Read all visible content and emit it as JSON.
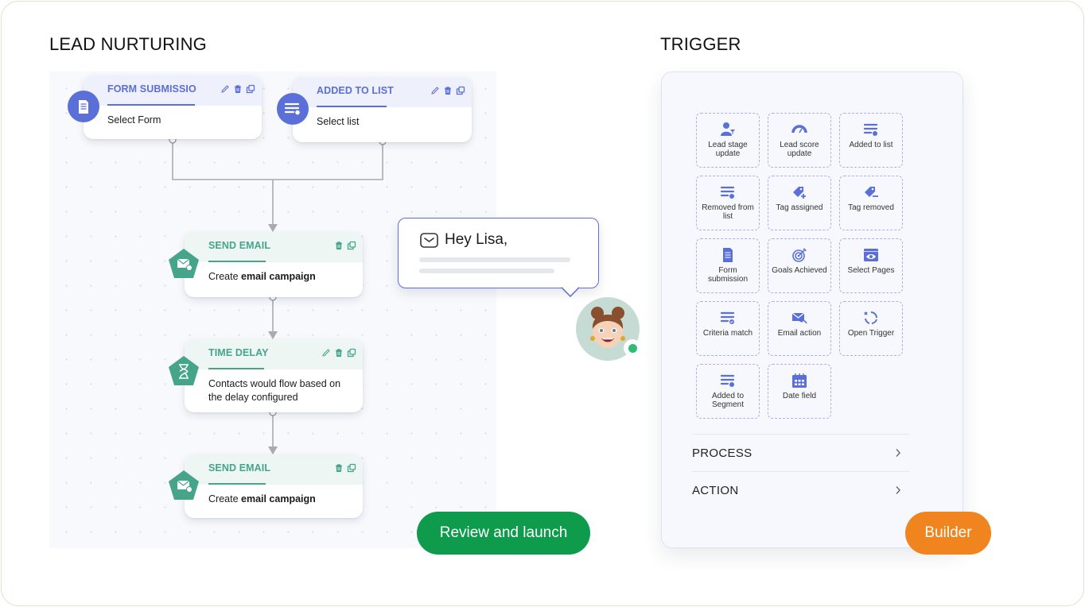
{
  "sections": {
    "lead_nurturing_title": "LEAD NURTURING",
    "trigger_title": "TRIGGER"
  },
  "colors": {
    "blue_accent": "#5b6fd8",
    "green_accent": "#45a48a",
    "launch_button": "#0e9b4b",
    "builder_button": "#f0841e",
    "online_status": "#2ebd74"
  },
  "workflow": {
    "nodes": [
      {
        "title": "FORM SUBMISSION",
        "body": "Select Form",
        "icon": "form-icon",
        "actions": [
          "edit",
          "delete",
          "duplicate"
        ]
      },
      {
        "title": "ADDED TO LIST",
        "body": "Select list",
        "icon": "list-icon",
        "actions": [
          "edit",
          "delete",
          "duplicate"
        ]
      },
      {
        "title": "SEND EMAIL",
        "body_prefix": "Create ",
        "body_bold": "email campaign",
        "icon": "email-icon",
        "actions": [
          "delete",
          "duplicate"
        ]
      },
      {
        "title": "TIME DELAY",
        "body": "Contacts would flow based on the delay configured",
        "icon": "hourglass-icon",
        "actions": [
          "edit",
          "delete",
          "duplicate"
        ]
      },
      {
        "title": "SEND EMAIL",
        "body_prefix": "Create ",
        "body_bold": "email campaign",
        "icon": "email-icon",
        "actions": [
          "delete",
          "duplicate"
        ]
      }
    ]
  },
  "email_preview": {
    "greeting": "Hey Lisa,",
    "icon": "mail-icon"
  },
  "avatar": {
    "status": "online"
  },
  "buttons": {
    "review_launch": "Review and launch",
    "builder": "Builder"
  },
  "trigger_panel": {
    "tiles": [
      {
        "label": "Lead stage update",
        "icon": "lead-stage-icon"
      },
      {
        "label": "Lead score update",
        "icon": "gauge-icon"
      },
      {
        "label": "Added to list",
        "icon": "list-add-icon"
      },
      {
        "label": "Removed from list",
        "icon": "list-remove-icon"
      },
      {
        "label": "Tag assigned",
        "icon": "tag-add-icon"
      },
      {
        "label": "Tag removed",
        "icon": "tag-remove-icon"
      },
      {
        "label": "Form submission",
        "icon": "form-icon"
      },
      {
        "label": "Goals Achieved",
        "icon": "target-icon"
      },
      {
        "label": "Select Pages",
        "icon": "eye-page-icon"
      },
      {
        "label": "Criteria match",
        "icon": "criteria-icon"
      },
      {
        "label": "Email action",
        "icon": "email-action-icon"
      },
      {
        "label": "Open Trigger",
        "icon": "cycle-icon"
      },
      {
        "label": "Added to Segment",
        "icon": "segment-icon"
      },
      {
        "label": "Date field",
        "icon": "calendar-icon"
      }
    ],
    "sections": [
      {
        "label": "PROCESS"
      },
      {
        "label": "ACTION"
      }
    ]
  }
}
